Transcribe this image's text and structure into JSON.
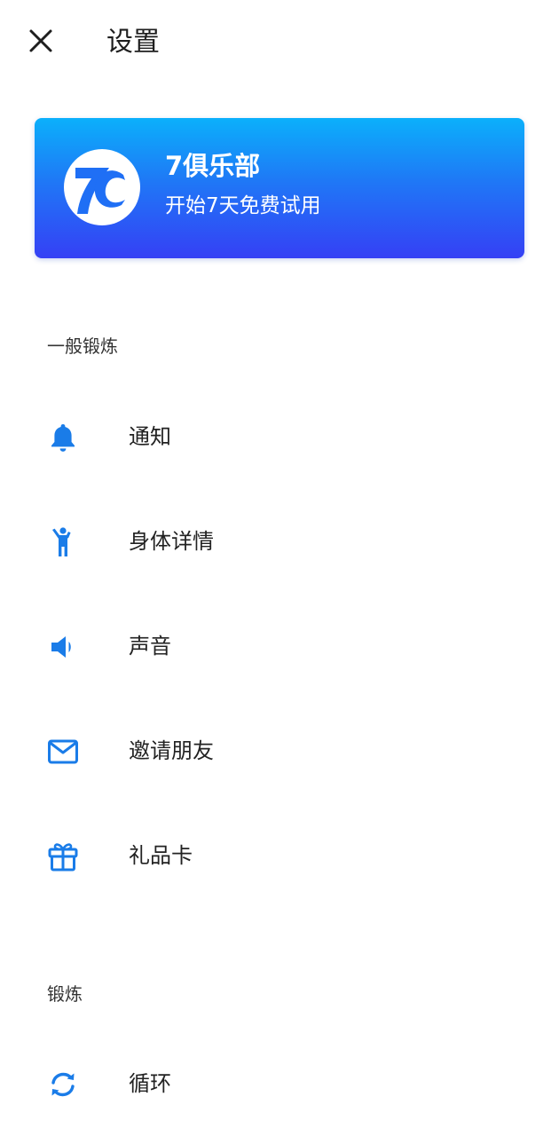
{
  "header": {
    "title": "设置"
  },
  "promo": {
    "title": "7俱乐部",
    "subtitle": "开始7天免费试用"
  },
  "sections": {
    "general": {
      "title": "一般锻炼",
      "items": [
        {
          "label": "通知",
          "icon": "bell-icon"
        },
        {
          "label": "身体详情",
          "icon": "person-icon"
        },
        {
          "label": "声音",
          "icon": "speaker-icon"
        },
        {
          "label": "邀请朋友",
          "icon": "mail-icon"
        },
        {
          "label": "礼品卡",
          "icon": "gift-icon"
        }
      ]
    },
    "workout": {
      "title": "锻炼",
      "items": [
        {
          "label": "循环",
          "icon": "repeat-icon"
        }
      ]
    }
  },
  "colors": {
    "accent": "#1a7ce8",
    "promo_gradient_top": "#0bb0fb",
    "promo_gradient_bottom": "#3540f5"
  }
}
